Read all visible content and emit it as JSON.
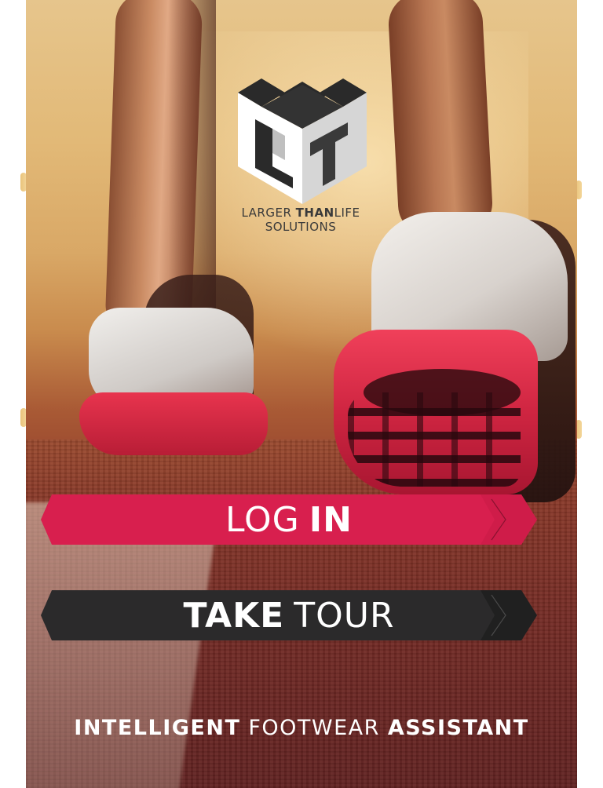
{
  "brand": {
    "logo_icon": "ltl-cube-logo-icon",
    "name_part1": "LARGER",
    "name_part2": "THAN",
    "name_part3": "LIFE",
    "name_line2": "SOLUTIONS"
  },
  "actions": {
    "login": {
      "part1": "LOG",
      "part2": "IN",
      "color": "#d81f4e"
    },
    "tour": {
      "part1": "TAKE",
      "part2": "TOUR",
      "color": "#2b2a2b"
    }
  },
  "tagline": {
    "part1": "INTELLIGENT",
    "part2": "FOOTWEAR",
    "part3": "ASSISTANT"
  },
  "background": {
    "subject": "runner-feet-background",
    "accent": "#e8344e"
  }
}
